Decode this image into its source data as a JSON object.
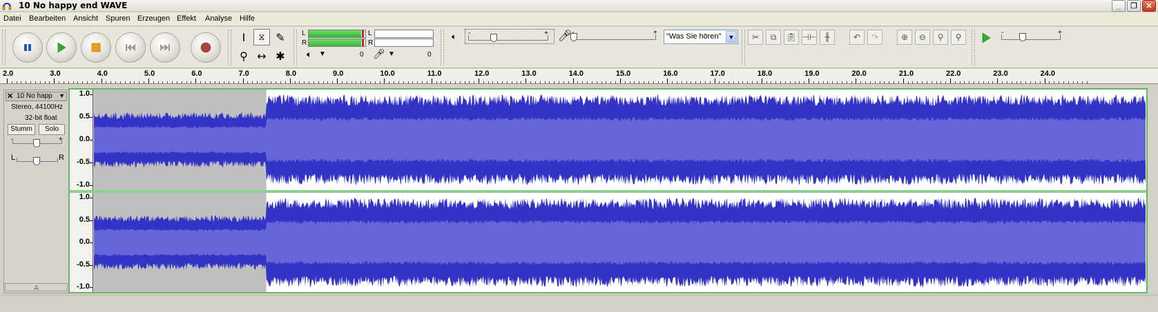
{
  "window": {
    "title": "10 No happy end WAVE",
    "controls": [
      "minimize",
      "maximize",
      "close"
    ]
  },
  "menu": [
    "Datei",
    "Bearbeiten",
    "Ansicht",
    "Spuren",
    "Erzeugen",
    "Effekt",
    "Analyse",
    "Hilfe"
  ],
  "transport": {
    "buttons": [
      "pause-icon",
      "play-icon",
      "stop-icon",
      "skip-start-icon",
      "skip-end-icon",
      "record-icon"
    ]
  },
  "meters": {
    "play_l_label": "L",
    "play_r_label": "R",
    "rec_l_label": "L",
    "rec_r_label": "R",
    "play_value": "0",
    "rec_value": "0",
    "play_fill_fraction": 0.93
  },
  "mixer": {
    "output_minus": "-",
    "output_plus": "+",
    "input_minus": "-",
    "input_plus": "+",
    "input_source": "\"Was Sie hören\"",
    "playback_minus": "-",
    "playback_plus": "+"
  },
  "ruler": {
    "labels": [
      "2.0",
      "3.0",
      "4.0",
      "5.0",
      "6.0",
      "7.0",
      "8.0",
      "9.0",
      "10.0",
      "11.0",
      "12.0",
      "13.0",
      "14.0",
      "15.0",
      "16.0",
      "17.0",
      "18.0",
      "19.0",
      "20.0",
      "21.0",
      "22.0",
      "23.0",
      "24.0"
    ]
  },
  "track": {
    "name": "10 No happ",
    "format": "Stereo, 44100Hz",
    "bit_depth": "32-bit float",
    "mute_label": "Stumm",
    "solo_label": "Solo",
    "gain_minus": "-",
    "gain_plus": "+",
    "pan_left": "L",
    "pan_right": "R",
    "scale_labels": [
      "1.0",
      "0.5",
      "0.0",
      "-0.5",
      "-1.0"
    ],
    "selection_end_seconds": 7.5,
    "colors": {
      "waveform": "#3333c6",
      "rms": "#6666d9",
      "selection_bg": "#bfbfbf",
      "background": "#ffffff",
      "frame": "#5dbb5d"
    }
  }
}
